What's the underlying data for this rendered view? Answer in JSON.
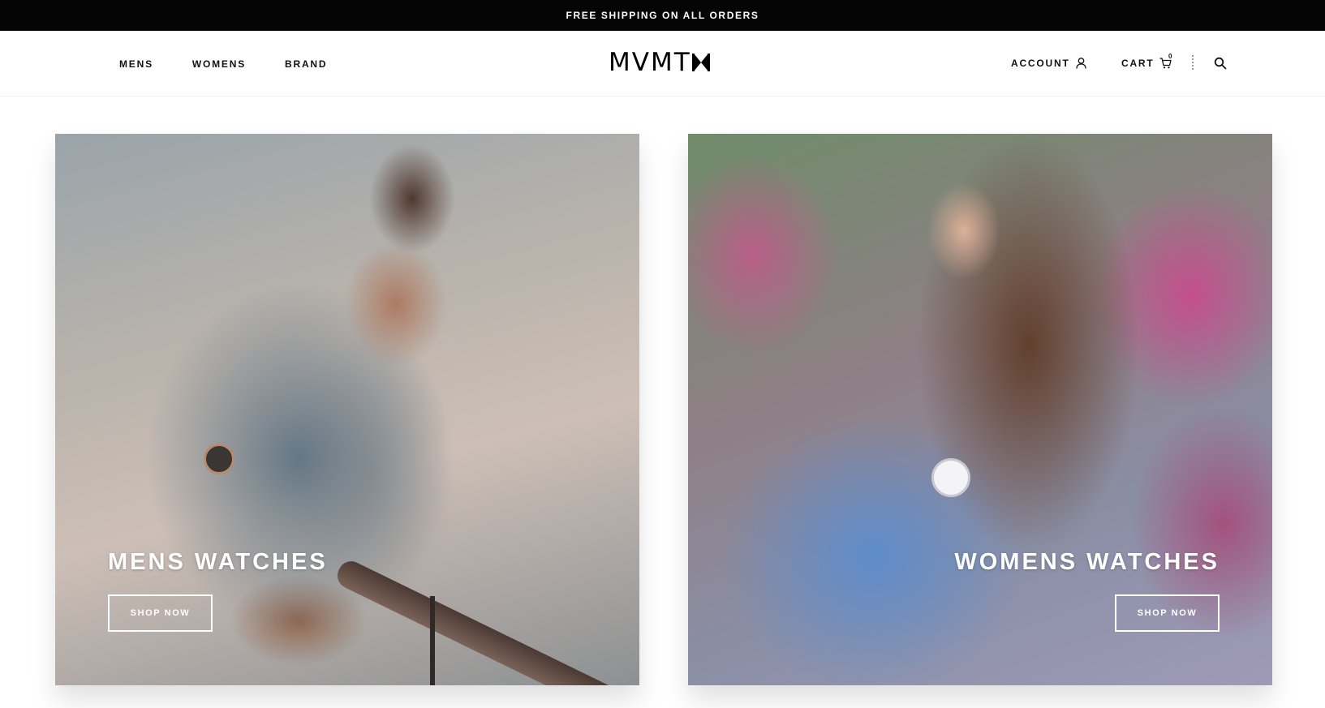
{
  "promo": {
    "text": "FREE SHIPPING ON ALL ORDERS"
  },
  "header": {
    "nav": [
      {
        "label": "MENS"
      },
      {
        "label": "WOMENS"
      },
      {
        "label": "BRAND"
      }
    ],
    "logo_text": "MVMT",
    "account_label": "ACCOUNT",
    "cart_label": "CART",
    "cart_count": "0"
  },
  "tiles": [
    {
      "title": "MENS WATCHES",
      "button": "SHOP NOW"
    },
    {
      "title": "WOMENS WATCHES",
      "button": "SHOP NOW"
    }
  ]
}
